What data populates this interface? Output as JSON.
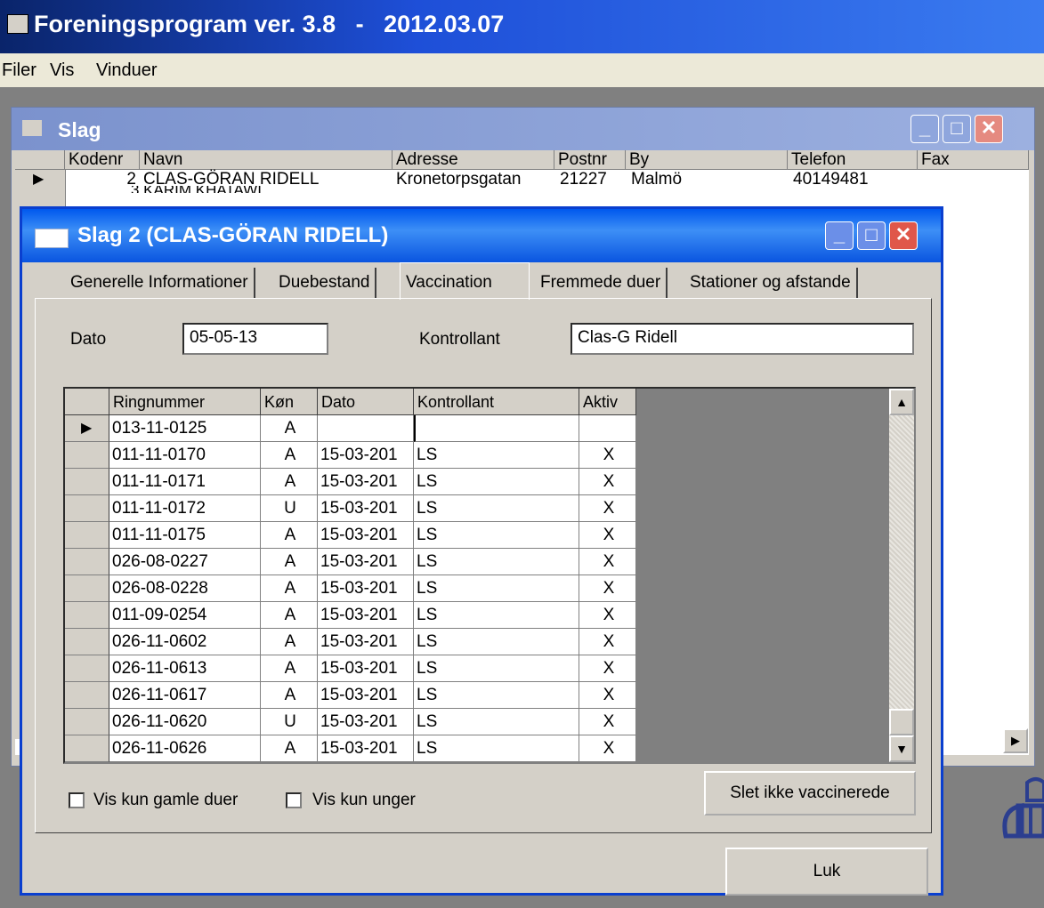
{
  "app": {
    "title": "Foreningsprogram ver. 3.8   -   2012.03.07"
  },
  "menu": [
    {
      "label": "Filer"
    },
    {
      "label": "Vis"
    },
    {
      "label": "Vinduer"
    }
  ],
  "slag_window": {
    "title": "Slag",
    "columns": [
      "Kodenr",
      "Navn",
      "Adresse",
      "Postnr",
      "By",
      "Telefon",
      "Fax"
    ],
    "row": {
      "kodenr": "2",
      "navn": "CLAS-GÖRAN RIDELL",
      "adresse": "Kronetorpsgatan",
      "postnr": "21227",
      "by": "Malmö",
      "telefon": "40149481"
    },
    "partial_row": "3 KARIM KHATAWI"
  },
  "dialog": {
    "title": "Slag 2 (CLAS-GÖRAN RIDELL)",
    "tabs": [
      {
        "label": "Generelle Informationer"
      },
      {
        "label": "Duebestand"
      },
      {
        "label": "Vaccination",
        "active": true
      },
      {
        "label": "Fremmede duer"
      },
      {
        "label": "Stationer og afstande"
      }
    ],
    "dato_label": "Dato",
    "dato_value": "05-05-13",
    "kontrollant_label": "Kontrollant",
    "kontrollant_value": "Clas-G Ridell",
    "grid": {
      "columns": [
        "Ringnummer",
        "Køn",
        "Dato",
        "Kontrollant",
        "Aktiv"
      ],
      "rows": [
        [
          "013-11-0125",
          "A",
          "",
          "",
          ""
        ],
        [
          "011-11-0170",
          "A",
          "15-03-201",
          "LS",
          "X"
        ],
        [
          "011-11-0171",
          "A",
          "15-03-201",
          "LS",
          "X"
        ],
        [
          "011-11-0172",
          "U",
          "15-03-201",
          "LS",
          "X"
        ],
        [
          "011-11-0175",
          "A",
          "15-03-201",
          "LS",
          "X"
        ],
        [
          "026-08-0227",
          "A",
          "15-03-201",
          "LS",
          "X"
        ],
        [
          "026-08-0228",
          "A",
          "15-03-201",
          "LS",
          "X"
        ],
        [
          "011-09-0254",
          "A",
          "15-03-201",
          "LS",
          "X"
        ],
        [
          "026-11-0602",
          "A",
          "15-03-201",
          "LS",
          "X"
        ],
        [
          "026-11-0613",
          "A",
          "15-03-201",
          "LS",
          "X"
        ],
        [
          "026-11-0617",
          "A",
          "15-03-201",
          "LS",
          "X"
        ],
        [
          "026-11-0620",
          "U",
          "15-03-201",
          "LS",
          "X"
        ],
        [
          "026-11-0626",
          "A",
          "15-03-201",
          "LS",
          "X"
        ]
      ]
    },
    "checkbox_old": "Vis kun gamle duer",
    "checkbox_young": "Vis kun unger",
    "delete_button": "Slet ikke vaccinerede",
    "close_button": "Luk"
  }
}
